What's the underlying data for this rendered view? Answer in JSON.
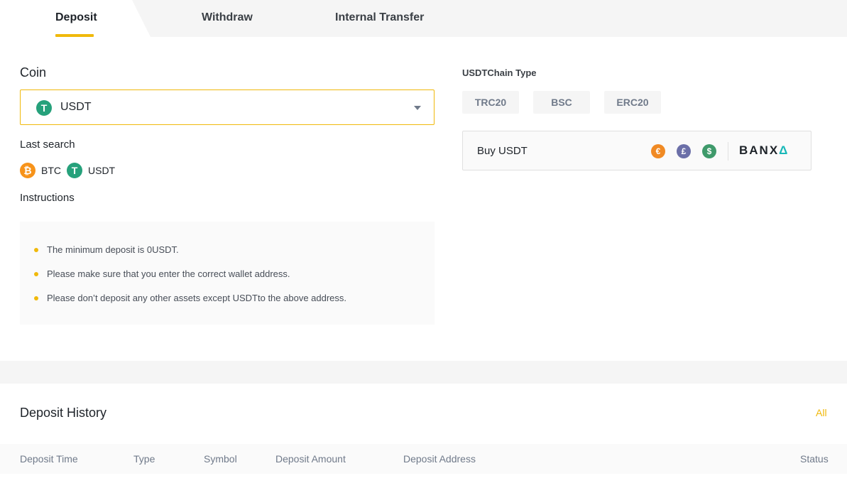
{
  "tabs": {
    "deposit": "Deposit",
    "withdraw": "Withdraw",
    "internal_transfer": "Internal Transfer"
  },
  "coin": {
    "label": "Coin",
    "selected": "USDT",
    "icon": "tether-icon",
    "icon_glyph": "T"
  },
  "last_search": {
    "label": "Last search",
    "items": [
      {
        "name": "BTC",
        "icon": "bitcoin-icon",
        "glyph": "₿",
        "color": "#f7931a"
      },
      {
        "name": "USDT",
        "icon": "tether-icon",
        "glyph": "T",
        "color": "#26a17b"
      }
    ]
  },
  "instructions": {
    "label": "Instructions",
    "items": [
      "The minimum deposit is 0USDT.",
      "Please make sure that you enter the correct wallet address.",
      "Please don’t deposit any other assets except USDTto the above address."
    ]
  },
  "chain": {
    "label": "USDTChain Type",
    "options": [
      "TRC20",
      "BSC",
      "ERC20"
    ]
  },
  "buy": {
    "label": "Buy  USDT",
    "currencies": [
      {
        "glyph": "€",
        "icon": "euro-icon"
      },
      {
        "glyph": "£",
        "icon": "pound-icon"
      },
      {
        "glyph": "$",
        "icon": "dollar-icon"
      }
    ],
    "provider": "BANX",
    "provider_mark": "Δ"
  },
  "history": {
    "title": "Deposit History",
    "all_link": "All",
    "columns": [
      "Deposit Time",
      "Type",
      "Symbol",
      "Deposit Amount",
      "Deposit Address",
      "Status"
    ]
  },
  "colors": {
    "accent": "#f0b90b",
    "tether": "#26a17b",
    "bitcoin": "#f7931a"
  }
}
